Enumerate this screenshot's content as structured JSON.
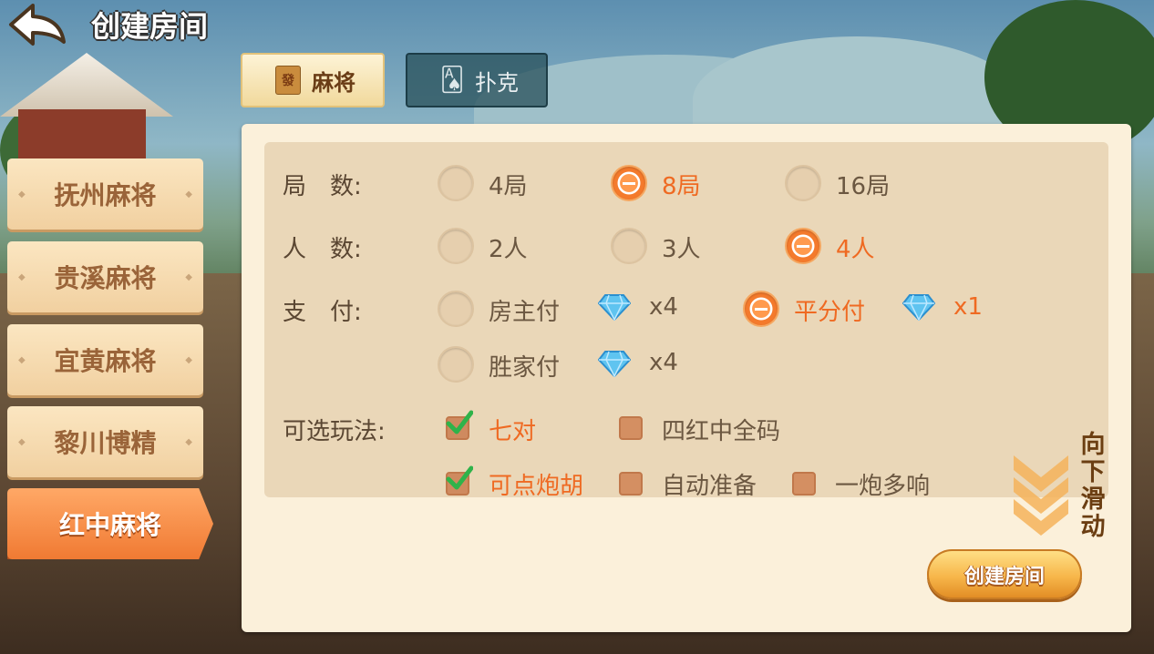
{
  "header": {
    "title": "创建房间"
  },
  "tabs": [
    {
      "label": "麻将",
      "icon": "mahjong-tile-icon",
      "icon_glyph": "發",
      "active": true
    },
    {
      "label": "扑克",
      "icon": "playing-cards-icon",
      "active": false
    }
  ],
  "categories": [
    {
      "label": "抚州麻将",
      "active": false
    },
    {
      "label": "贵溪麻将",
      "active": false
    },
    {
      "label": "宜黄麻将",
      "active": false
    },
    {
      "label": "黎川博精",
      "active": false
    },
    {
      "label": "红中麻将",
      "active": true
    }
  ],
  "settings": {
    "rounds": {
      "label": "局　数:",
      "options": [
        "4局",
        "8局",
        "16局"
      ],
      "selected": "8局"
    },
    "players": {
      "label": "人　数:",
      "options": [
        "2人",
        "3人",
        "4人"
      ],
      "selected": "4人"
    },
    "payment": {
      "label": "支　付:",
      "options": [
        {
          "name": "房主付",
          "cost": "x4"
        },
        {
          "name": "平分付",
          "cost": "x1"
        },
        {
          "name": "胜家付",
          "cost": "x4"
        }
      ],
      "selected": "平分付"
    },
    "rules": {
      "label": "可选玩法:",
      "options": [
        {
          "name": "七对",
          "checked": true
        },
        {
          "name": "四红中全码",
          "checked": false
        },
        {
          "name": "可点炮胡",
          "checked": true
        },
        {
          "name": "自动准备",
          "checked": false
        },
        {
          "name": "一炮多响",
          "checked": false
        }
      ]
    }
  },
  "scroll_hint": [
    "向",
    "下",
    "滑",
    "动"
  ],
  "create_button": "创建房间",
  "colors": {
    "accent": "#ef6a22",
    "panel": "#fbf0da",
    "options_bg": "#ead7b8"
  }
}
